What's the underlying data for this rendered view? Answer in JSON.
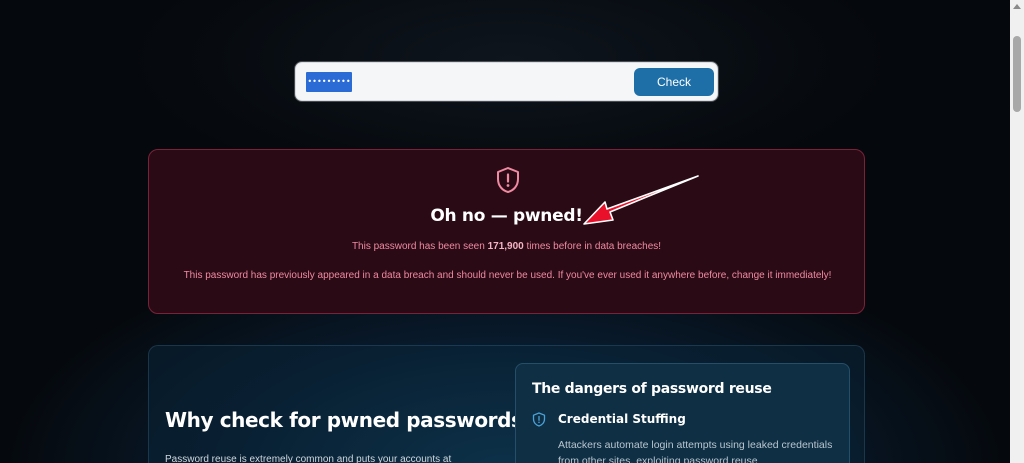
{
  "search": {
    "password_value": "•••••••••",
    "check_label": "Check"
  },
  "alert": {
    "title": "Oh no — pwned!",
    "count_prefix": "This password has been seen ",
    "count_value": "171,900",
    "count_suffix": " times before in data breaches!",
    "advice": "This password has previously appeared in a data breach and should never be used. If you've ever used it anywhere before, change it immediately!"
  },
  "info": {
    "heading": "Why check for pwned passwords?",
    "body": "Password reuse is extremely common and puts your accounts at",
    "dangers_title": "The dangers of password reuse",
    "items": [
      {
        "title": "Credential Stuffing",
        "description": "Attackers automate login attempts using leaked credentials from other sites, exploiting password reuse"
      }
    ]
  },
  "colors": {
    "alert_bg": "#2a0a14",
    "alert_border": "#7a2238",
    "alert_text": "#f08aa3",
    "accent_button": "#1e6fa8",
    "annotation_arrow": "#e8102a"
  },
  "icons": [
    "shield-alert-icon",
    "shield-alert-small-icon",
    "annotation-arrow"
  ]
}
